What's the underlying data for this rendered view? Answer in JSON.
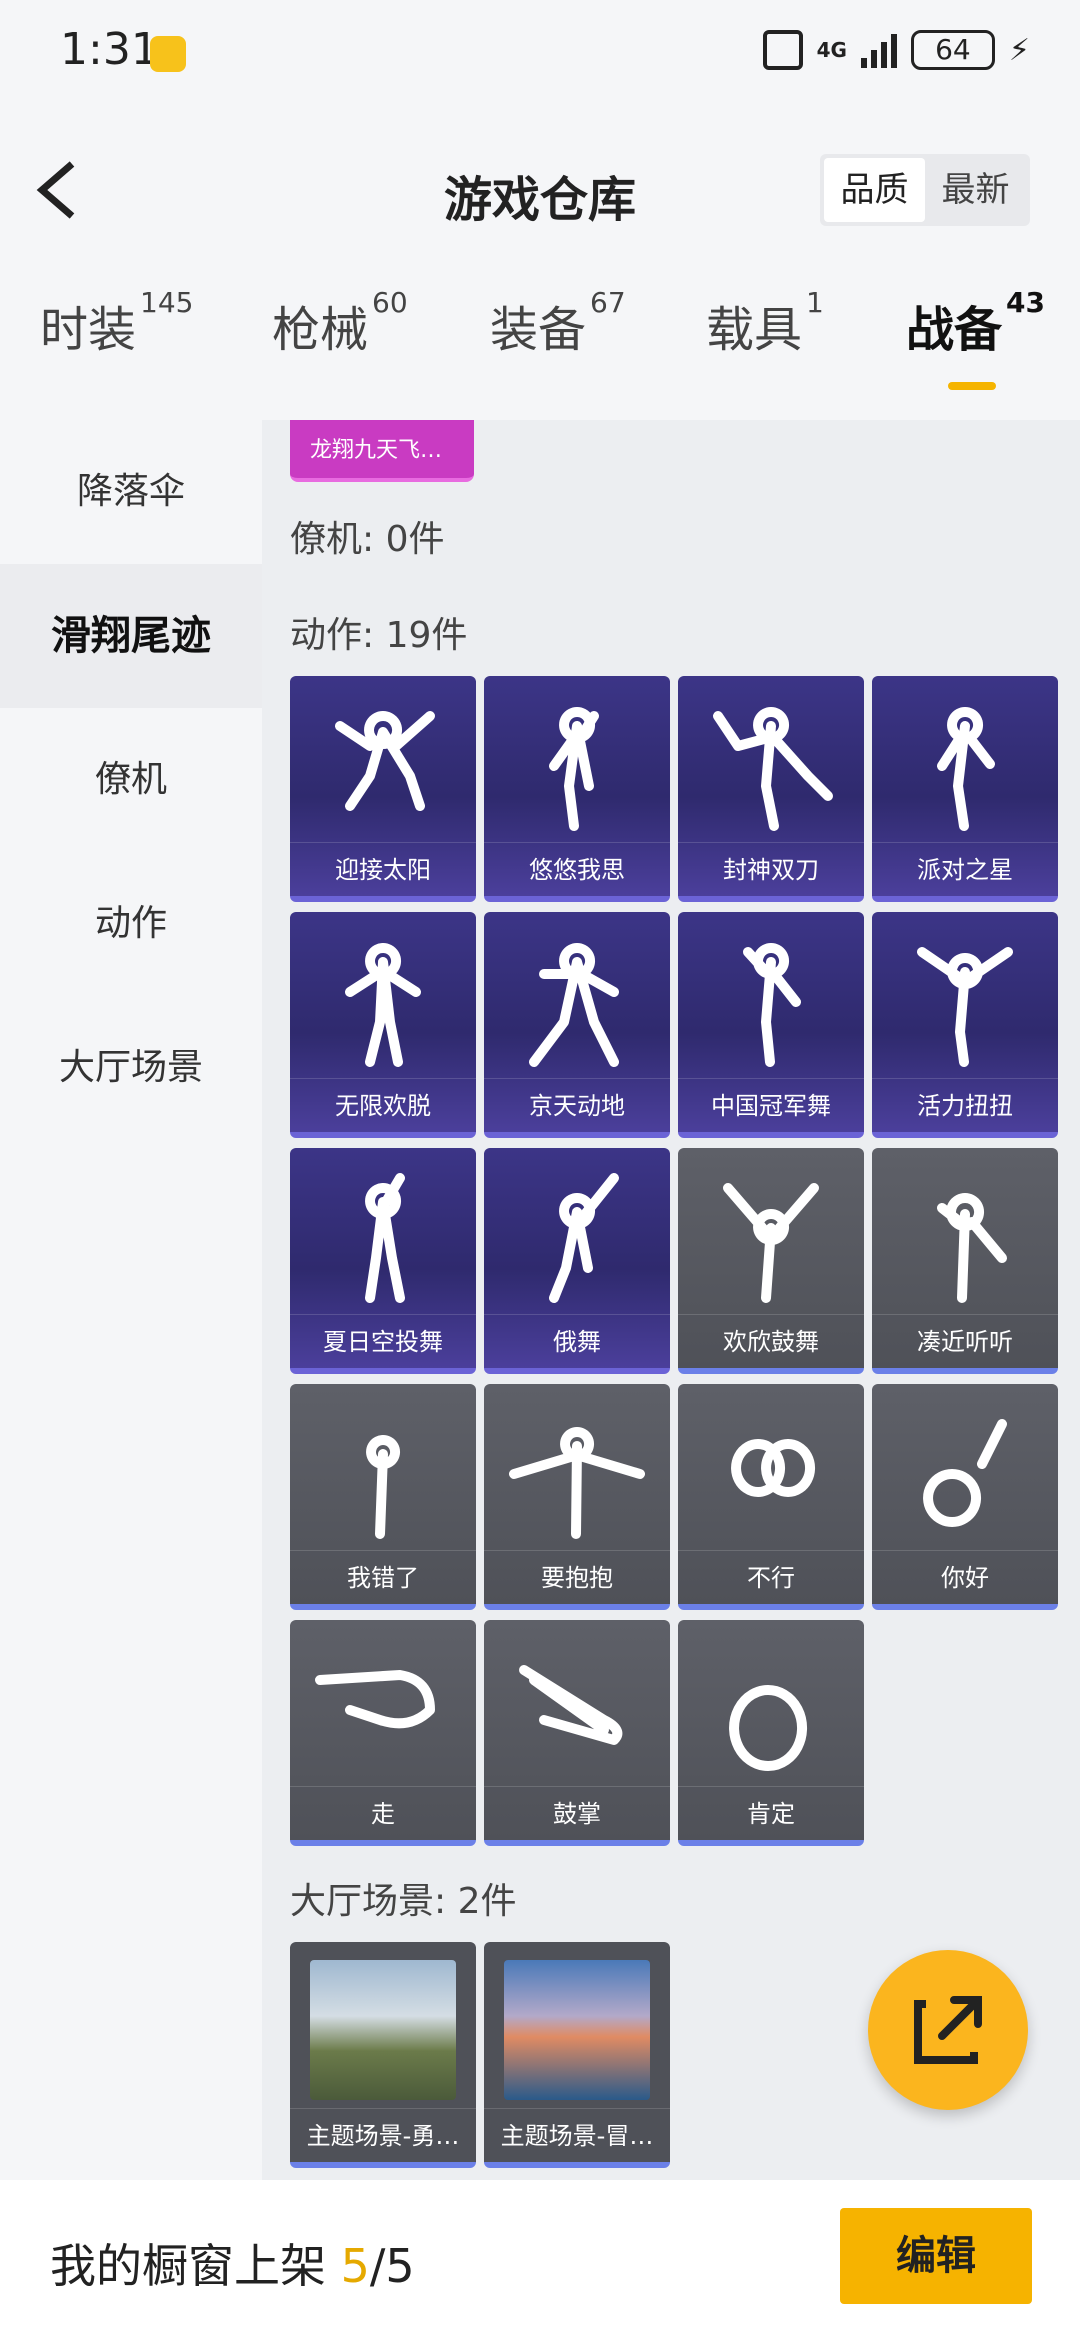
{
  "status_bar": {
    "time": "1:31",
    "network": "4G",
    "battery": "64"
  },
  "header": {
    "title": "游戏仓库",
    "sort": [
      "品质",
      "最新"
    ],
    "sort_active": 0
  },
  "tabs": [
    {
      "label": "时装",
      "count": "145"
    },
    {
      "label": "枪械",
      "count": "60"
    },
    {
      "label": "装备",
      "count": "67"
    },
    {
      "label": "载具",
      "count": "1"
    },
    {
      "label": "战备",
      "count": "43"
    }
  ],
  "sidenav": [
    "降落伞",
    "滑翔尾迹",
    "僚机",
    "动作",
    "大厅场景"
  ],
  "sidenav_active": 1,
  "content": {
    "top_item": "龙翔九天飞…",
    "wingman_section": "僚机: 0件",
    "emote_section": "动作: 19件",
    "emotes": [
      {
        "name": "迎接太阳",
        "style": "purple"
      },
      {
        "name": "悠悠我思",
        "style": "purple"
      },
      {
        "name": "封神双刀",
        "style": "purple"
      },
      {
        "name": "派对之星",
        "style": "purple"
      },
      {
        "name": "无限欢脱",
        "style": "purple"
      },
      {
        "name": "京天动地",
        "style": "purple"
      },
      {
        "name": "中国冠军舞",
        "style": "purple"
      },
      {
        "name": "活力扭扭",
        "style": "purple"
      },
      {
        "name": "夏日空投舞",
        "style": "purple"
      },
      {
        "name": "俄舞",
        "style": "purple"
      },
      {
        "name": "欢欣鼓舞",
        "style": "gray"
      },
      {
        "name": "凑近听听",
        "style": "gray"
      },
      {
        "name": "我错了",
        "style": "gray"
      },
      {
        "name": "要抱抱",
        "style": "gray"
      },
      {
        "name": "不行",
        "style": "gray"
      },
      {
        "name": "你好",
        "style": "gray"
      },
      {
        "name": "走",
        "style": "gray"
      },
      {
        "name": "鼓掌",
        "style": "gray"
      },
      {
        "name": "肯定",
        "style": "gray"
      }
    ],
    "lobby_section": "大厅场景: 2件",
    "scenes": [
      "主题场景-勇…",
      "主题场景-冒…"
    ]
  },
  "bottom_bar": {
    "label": "我的橱窗上架",
    "current": "5",
    "total": "/5",
    "edit_label": "编辑"
  },
  "colors": {
    "accent": "#f5b400",
    "purple_card": "#3c3587",
    "gray_card": "#55575e",
    "rare_border": "#6b80e8"
  }
}
